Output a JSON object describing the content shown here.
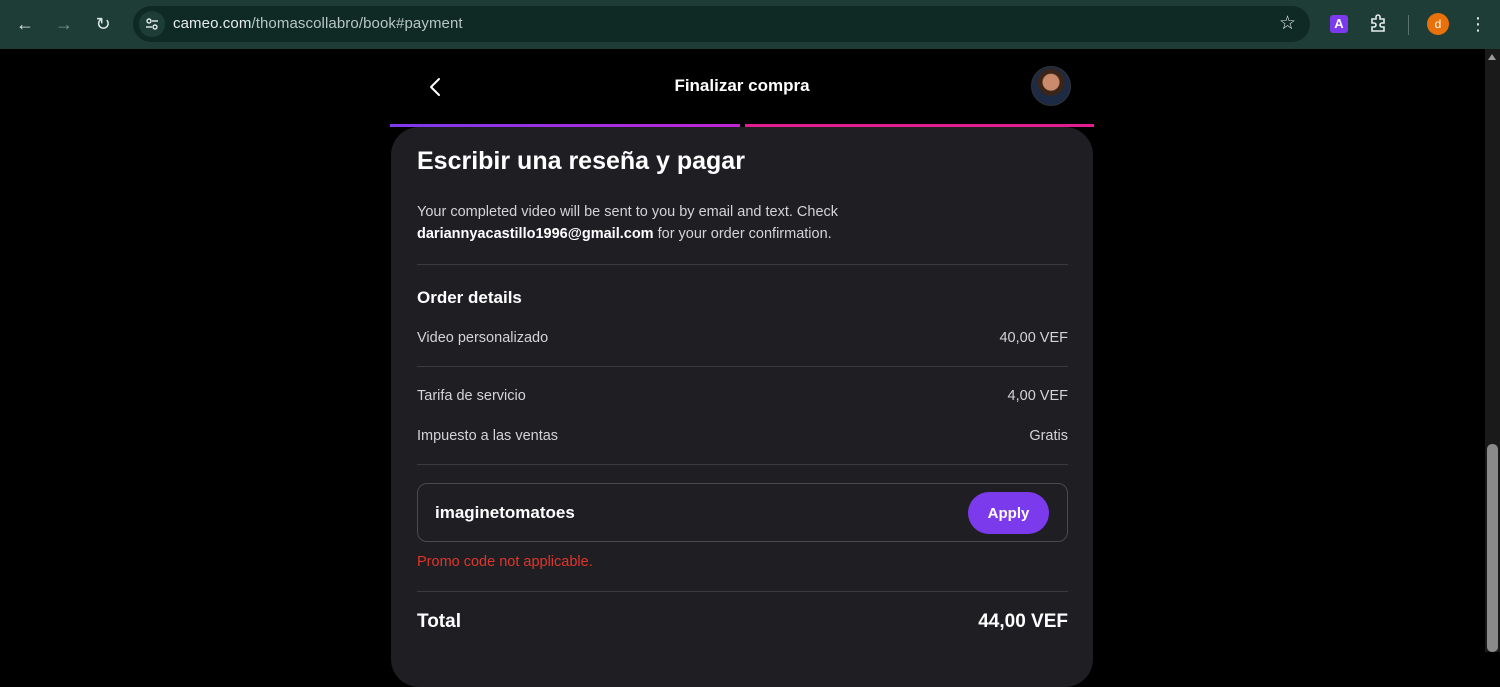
{
  "browser": {
    "url_host": "cameo.com",
    "url_path": "/thomascollabro/book#payment",
    "profile_initial": "d",
    "extension_letter": "A"
  },
  "header": {
    "title": "Finalizar compra"
  },
  "card": {
    "title": "Escribir una reseña y pagar",
    "desc_prefix": "Your completed video will be sent to you by email and text. Check ",
    "email": "dariannyacastillo1996@gmail.com",
    "desc_suffix": " for your order confirmation."
  },
  "order": {
    "section_title": "Order details",
    "rows": [
      {
        "label": "Video personalizado",
        "value": "40,00 VEF"
      },
      {
        "label": "Tarifa de servicio",
        "value": "4,00 VEF"
      },
      {
        "label": "Impuesto a las ventas",
        "value": "Gratis"
      }
    ]
  },
  "promo": {
    "value": "imaginetomatoes",
    "apply_label": "Apply",
    "error": "Promo code not applicable."
  },
  "total": {
    "label": "Total",
    "value": "44,00 VEF"
  },
  "colors": {
    "accent": "#7c3aed",
    "progress_pink": "#e11d8f",
    "error": "#e0352b",
    "card_bg": "#1f1e23",
    "chrome_bg": "#1f3d37"
  }
}
